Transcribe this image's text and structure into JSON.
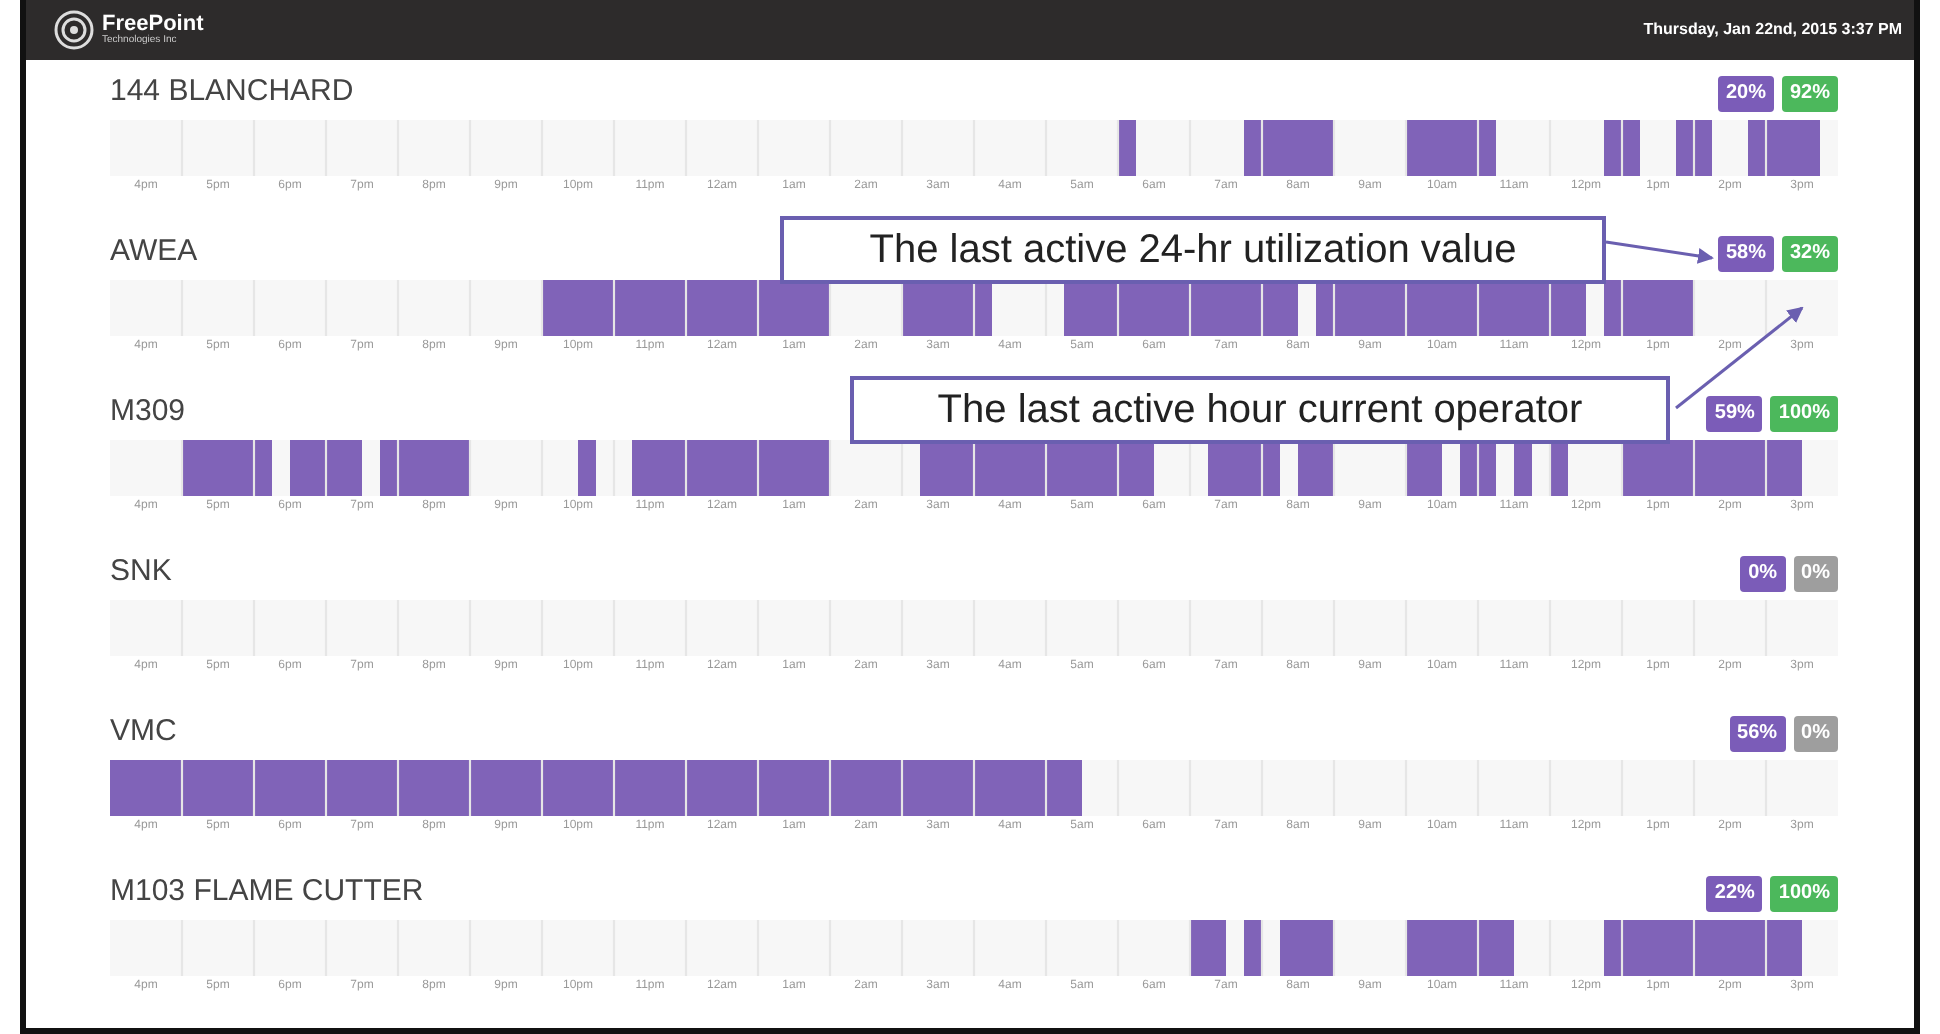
{
  "header": {
    "brand": "FreePoint",
    "brand_sub": "Technologies Inc",
    "datetime": "Thursday, Jan 22nd, 2015 3:37 PM"
  },
  "machines": [
    {
      "name": "144 BLANCHARD",
      "badges": [
        {
          "text": "20%",
          "color": "#7b5cb8"
        },
        {
          "text": "92%",
          "color": "#4cb85c"
        }
      ],
      "hour_labels": [
        "4pm",
        "5pm",
        "6pm",
        "7pm",
        "8pm",
        "9pm",
        "10pm",
        "11pm",
        "12am",
        "1am",
        "2am",
        "3am",
        "4am",
        "5am",
        "6am",
        "7am",
        "8am",
        "9am",
        "10am",
        "11am",
        "12pm",
        "1pm",
        "2pm",
        "3pm"
      ]
    },
    {
      "name": "AWEA",
      "badges": [
        {
          "text": "58%",
          "color": "#7b5cb8"
        },
        {
          "text": "32%",
          "color": "#4cb85c"
        }
      ],
      "hour_labels": [
        "4pm",
        "5pm",
        "6pm",
        "7pm",
        "8pm",
        "9pm",
        "10pm",
        "11pm",
        "12am",
        "1am",
        "2am",
        "3am",
        "4am",
        "5am",
        "6am",
        "7am",
        "8am",
        "9am",
        "10am",
        "11am",
        "12pm",
        "1pm",
        "2pm",
        "3pm"
      ]
    },
    {
      "name": "M309",
      "badges": [
        {
          "text": "59%",
          "color": "#7b5cb8"
        },
        {
          "text": "100%",
          "color": "#4cb85c"
        }
      ],
      "hour_labels": [
        "4pm",
        "5pm",
        "6pm",
        "7pm",
        "8pm",
        "9pm",
        "10pm",
        "11pm",
        "12am",
        "1am",
        "2am",
        "3am",
        "4am",
        "5am",
        "6am",
        "7am",
        "8am",
        "9am",
        "10am",
        "11am",
        "12pm",
        "1pm",
        "2pm",
        "3pm"
      ]
    },
    {
      "name": "SNK",
      "badges": [
        {
          "text": "0%",
          "color": "#7b5cb8"
        },
        {
          "text": "0%",
          "color": "#9e9e9e"
        }
      ],
      "hour_labels": [
        "4pm",
        "5pm",
        "6pm",
        "7pm",
        "8pm",
        "9pm",
        "10pm",
        "11pm",
        "12am",
        "1am",
        "2am",
        "3am",
        "4am",
        "5am",
        "6am",
        "7am",
        "8am",
        "9am",
        "10am",
        "11am",
        "12pm",
        "1pm",
        "2pm",
        "3pm"
      ]
    },
    {
      "name": "VMC",
      "badges": [
        {
          "text": "56%",
          "color": "#7b5cb8"
        },
        {
          "text": "0%",
          "color": "#9e9e9e"
        }
      ],
      "hour_labels": [
        "4pm",
        "5pm",
        "6pm",
        "7pm",
        "8pm",
        "9pm",
        "10pm",
        "11pm",
        "12am",
        "1am",
        "2am",
        "3am",
        "4am",
        "5am",
        "6am",
        "7am",
        "8am",
        "9am",
        "10am",
        "11am",
        "12pm",
        "1pm",
        "2pm",
        "3pm"
      ]
    },
    {
      "name": "M103 FLAME CUTTER",
      "badges": [
        {
          "text": "22%",
          "color": "#7b5cb8"
        },
        {
          "text": "100%",
          "color": "#4cb85c"
        }
      ],
      "hour_labels": [
        "4pm",
        "5pm",
        "6pm",
        "7pm",
        "8pm",
        "9pm",
        "10pm",
        "11pm",
        "12am",
        "1am",
        "2am",
        "3am",
        "4am",
        "5am",
        "6am",
        "7am",
        "8am",
        "9am",
        "10am",
        "11am",
        "12pm",
        "1pm",
        "2pm",
        "3pm"
      ]
    }
  ],
  "callouts": [
    {
      "text": "The last active 24-hr utilization value"
    },
    {
      "text": "The last active hour current operator"
    }
  ]
}
